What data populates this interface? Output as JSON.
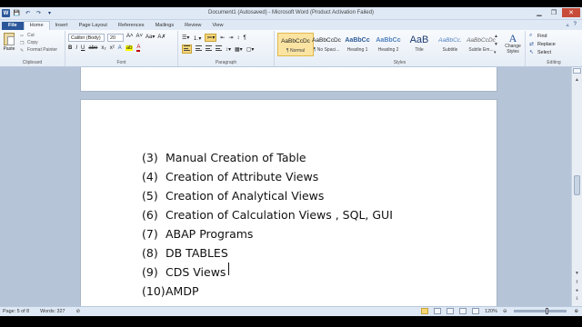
{
  "window": {
    "title": "Document1 (Autosaved) - Microsoft Word (Product Activation Failed)",
    "controls": {
      "minimize": "▁",
      "restore": "❐",
      "close": "✕"
    }
  },
  "quick_access": {
    "app_icon": "W",
    "save": "💾",
    "undo": "↶",
    "redo": "↷",
    "customize": "▾"
  },
  "tabs": [
    {
      "label": "File"
    },
    {
      "label": "Home"
    },
    {
      "label": "Insert"
    },
    {
      "label": "Page Layout"
    },
    {
      "label": "References"
    },
    {
      "label": "Mailings"
    },
    {
      "label": "Review"
    },
    {
      "label": "View"
    }
  ],
  "ribbon_controls": {
    "minimize": "▵",
    "help": "?"
  },
  "clipboard": {
    "paste": "Paste",
    "cut": "Cut",
    "copy": "Copy",
    "format_painter": "Format Painter",
    "group": "Clipboard"
  },
  "font": {
    "name": "Calibri (Body)",
    "size": "20",
    "grow": "A˄",
    "shrink": "A˅",
    "case": "Aa▾",
    "clear": "A✗",
    "bold": "B",
    "italic": "I",
    "underline": "U",
    "strike": "abe",
    "subscript": "x₂",
    "superscript": "x²",
    "effects": "A",
    "highlight": "ab",
    "color": "A",
    "group": "Font"
  },
  "paragraph": {
    "row1": [
      "☰▾",
      "⒈▾",
      "≔▾",
      "⇤",
      "⇥",
      "↕",
      "¶"
    ],
    "row2_after": [
      "↕▾",
      "▦▾",
      "▢▾"
    ],
    "group": "Paragraph"
  },
  "styles": {
    "items": [
      {
        "sample": "AaBbCcDc",
        "name": "¶ Normal"
      },
      {
        "sample": "AaBbCcDc",
        "name": "¶ No Spaci..."
      },
      {
        "sample": "AaBbCc",
        "name": "Heading 1"
      },
      {
        "sample": "AaBbCc",
        "name": "Heading 2"
      },
      {
        "sample": "AaB",
        "name": "Title"
      },
      {
        "sample": "AaBbCc.",
        "name": "Subtitle"
      },
      {
        "sample": "AaBbCcDc",
        "name": "Subtle Em..."
      }
    ],
    "change_styles": "Change Styles",
    "group": "Styles"
  },
  "editing": {
    "find": "Find",
    "replace": "Replace",
    "select": "Select",
    "group": "Editing"
  },
  "document": {
    "items": [
      {
        "num": "(3)",
        "text": "Manual Creation of Table"
      },
      {
        "num": "(4)",
        "text": "Creation of Attribute Views"
      },
      {
        "num": "(5)",
        "text": "Creation of Analytical Views"
      },
      {
        "num": "(6)",
        "text": "Creation of Calculation Views , SQL, GUI"
      },
      {
        "num": "(7)",
        "text": "ABAP Programs"
      },
      {
        "num": "(8)",
        "text": "DB TABLES"
      },
      {
        "num": "(9)",
        "text": "CDS Views"
      },
      {
        "num": "(10)",
        "text": "AMDP"
      }
    ]
  },
  "status": {
    "page": "Page: 5 of 8",
    "words": "Words: 327",
    "zoom": "120%",
    "zoom_fraction": 0.6
  },
  "colors": {
    "file_tab": "#2b579a",
    "close_button": "#c74d3a",
    "highlight": "#ffff00",
    "font_color": "#c00000",
    "doc_background": "#b6c4d8"
  }
}
